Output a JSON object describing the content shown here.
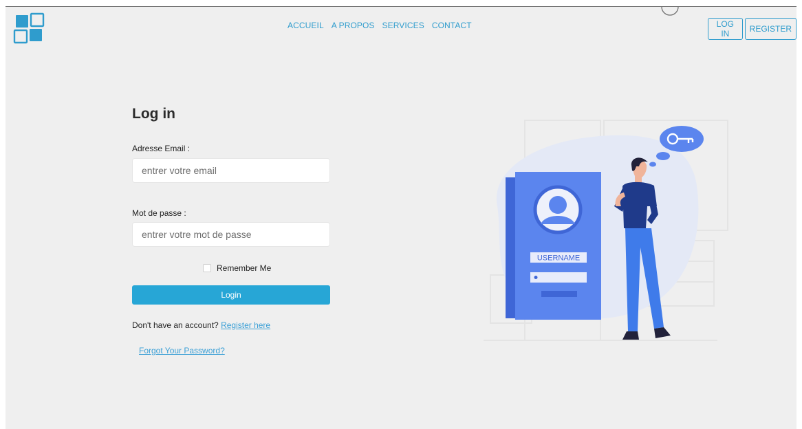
{
  "nav": {
    "items": [
      "ACCUEIL",
      "A PROPOS",
      "SERVICES",
      "CONTACT"
    ]
  },
  "auth": {
    "login_label": "LOG IN",
    "register_label": "REGISTER"
  },
  "form": {
    "title": "Log in",
    "email_label": "Adresse Email :",
    "email_placeholder": "entrer votre email",
    "password_label": "Mot de passe :",
    "password_placeholder": "entrer votre mot de passe",
    "remember_label": "Remember Me",
    "remember_checked": false,
    "submit_label": "Login",
    "no_account_text": "Don't have an account?",
    "register_link": "Register here",
    "forgot_link": "Forgot Your Password?"
  },
  "illustration": {
    "card_label": "USERNAME"
  },
  "colors": {
    "accent": "#27a6d6",
    "link": "#2f9ccd",
    "background": "#efefef",
    "card_blue": "#5b85ee"
  }
}
